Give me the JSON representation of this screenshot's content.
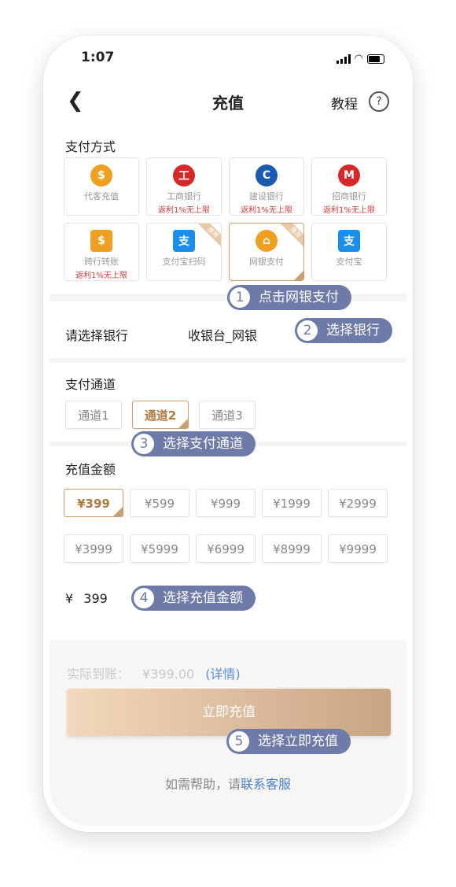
{
  "status": {
    "time": "1:07"
  },
  "nav": {
    "back": "<",
    "title": "充值",
    "tutorial": "教程",
    "help": "?"
  },
  "payment": {
    "label": "支付方式",
    "items": [
      {
        "name": "代客充值",
        "note": "",
        "icon": "coin-hand-icon",
        "color": "#f0a020"
      },
      {
        "name": "工商银行",
        "note": "返利1%无上限",
        "icon": "icbc-icon",
        "color": "#d62828"
      },
      {
        "name": "建设银行",
        "note": "返利1%无上限",
        "icon": "ccb-icon",
        "color": "#1a5ab0"
      },
      {
        "name": "招商银行",
        "note": "返利1%无上限",
        "icon": "cmb-icon",
        "color": "#d62828"
      },
      {
        "name": "跨行转账",
        "note": "返利1%无上限",
        "icon": "monitor-coin-icon",
        "color": "#f0a020"
      },
      {
        "name": "支付宝扫码",
        "note": "",
        "icon": "alipay-icon",
        "color": "#1a8ee8",
        "badge": "推荐"
      },
      {
        "name": "网银支付",
        "note": "",
        "icon": "bank-icon",
        "color": "#f0a020",
        "badge": "推荐",
        "active": true
      },
      {
        "name": "支付宝",
        "note": "",
        "icon": "alipay-icon",
        "color": "#1a8ee8"
      }
    ]
  },
  "bank": {
    "label": "请选择银行",
    "value": "收银台_网银"
  },
  "channel": {
    "label": "支付通道",
    "options": [
      "通道1",
      "通道2",
      "通道3"
    ],
    "selected": "通道2"
  },
  "amount": {
    "label": "充值金额",
    "options": [
      "¥399",
      "¥599",
      "¥999",
      "¥1999",
      "¥2999",
      "¥3999",
      "¥5999",
      "¥6999",
      "¥8999",
      "¥9999"
    ],
    "selected": "¥399",
    "currency": "¥",
    "entered": "399"
  },
  "summary": {
    "label": "实际到账：",
    "value": "¥399.00",
    "detail": "(详情)"
  },
  "cta": {
    "label": "立即充值"
  },
  "help": {
    "prefix": "如需帮助，请",
    "link": "联系客服"
  },
  "steps": [
    {
      "num": "1",
      "text": "点击网银支付"
    },
    {
      "num": "2",
      "text": "选择银行"
    },
    {
      "num": "3",
      "text": "选择支付通道"
    },
    {
      "num": "4",
      "text": "选择充值金额"
    },
    {
      "num": "5",
      "text": "选择立即充值"
    }
  ]
}
